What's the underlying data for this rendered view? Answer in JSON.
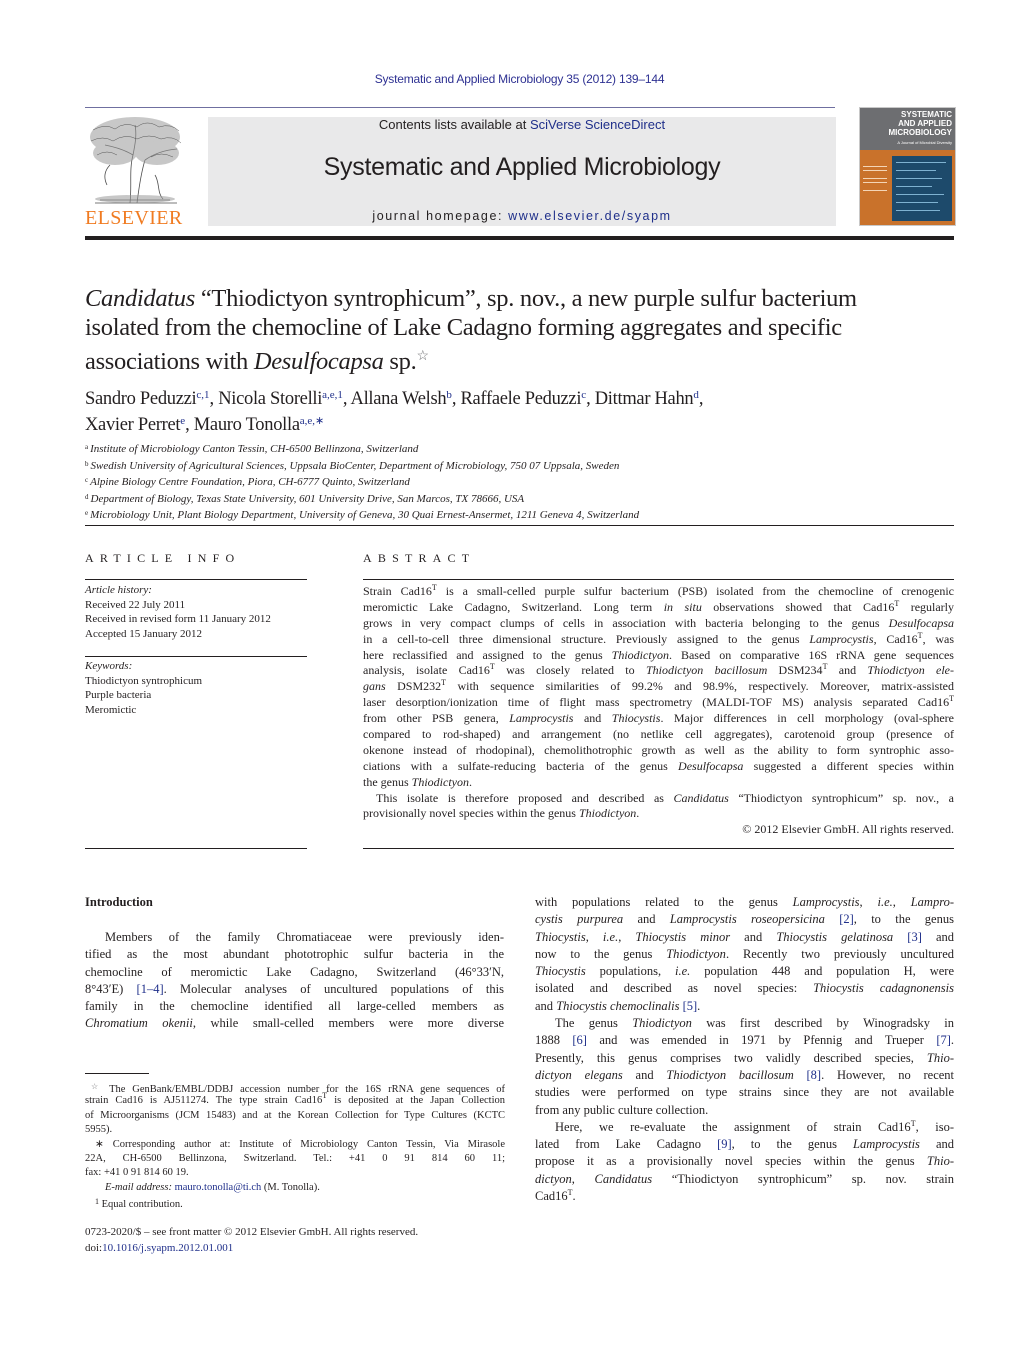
{
  "header": {
    "running_head": "Systematic and Applied Microbiology 35 (2012) 139–144",
    "contents_prefix": "Contents lists available at ",
    "contents_link": "SciVerse ScienceDirect",
    "journal_title": "Systematic and Applied Microbiology",
    "homepage_prefix": "journal homepage: ",
    "homepage_link": "www.elsevier.de/syapm",
    "publisher_logo_text": "ELSEVIER",
    "cover": {
      "title_line1": "SYSTEMATIC",
      "title_line2": "AND APPLIED",
      "title_line3": "MICROBIOLOGY",
      "subtitle": "A Journal of Microbial Diversity"
    },
    "brand_colors": {
      "elsevier_orange": "#f07b21",
      "link_blue": "#1f2f8a",
      "cover_orange": "#c9722b"
    }
  },
  "title": {
    "line1": {
      "italic": "Candidatus",
      "rest": " “Thiodictyon syntrophicum”, sp. nov., a new purple sulfur bacterium"
    },
    "line2": "isolated from the chemocline of Lake Cadagno forming aggregates and specific",
    "line3": {
      "pre": "associations with ",
      "italic": "Desulfocapsa",
      "post": " sp.",
      "footnote_mark": "☆"
    }
  },
  "authors": [
    {
      "name": "Sandro Peduzzi",
      "sup": "c,1",
      "sep": ", "
    },
    {
      "name": "Nicola Storelli",
      "sup": "a,e,1",
      "sep": ", "
    },
    {
      "name": "Allana Welsh",
      "sup": "b",
      "sep": ", "
    },
    {
      "name": "Raffaele Peduzzi",
      "sup": "c",
      "sep": ", "
    },
    {
      "name": "Dittmar Hahn",
      "sup": "d",
      "sep": ","
    },
    {
      "name": "Xavier Perret",
      "sup": "e",
      "sep": ", "
    },
    {
      "name": "Mauro Tonolla",
      "sup": "a,e,∗",
      "sep": ""
    }
  ],
  "affiliations": [
    {
      "letter": "a",
      "text": "Institute of Microbiology Canton Tessin, CH-6500 Bellinzona, Switzerland"
    },
    {
      "letter": "b",
      "text": "Swedish University of Agricultural Sciences, Uppsala BioCenter, Department of Microbiology, 750 07 Uppsala, Sweden"
    },
    {
      "letter": "c",
      "text": "Alpine Biology Centre Foundation, Piora, CH-6777 Quinto, Switzerland"
    },
    {
      "letter": "d",
      "text": "Department of Biology, Texas State University, 601 University Drive, San Marcos, TX 78666, USA"
    },
    {
      "letter": "e",
      "text": "Microbiology Unit, Plant Biology Department, University of Geneva, 30 Quai Ernest-Ansermet, 1211 Geneva 4, Switzerland"
    }
  ],
  "article_info": {
    "heading": "ARTICLE INFO",
    "history_label": "Article history:",
    "history": [
      "Received 22 July 2011",
      "Received in revised form 11 January 2012",
      "Accepted 15 January 2012"
    ],
    "keywords_label": "Keywords:",
    "keywords": [
      "Thiodictyon syntrophicum",
      "Purple bacteria",
      "Meromictic"
    ]
  },
  "abstract": {
    "heading": "ABSTRACT",
    "lines": [
      "Strain Cad16<sup class=\"t\">T</sup> is a small-celled purple sulfur bacterium (PSB) isolated from the chemocline of crenogenic",
      "meromictic Lake Cadagno, Switzerland. Long term <i>in situ</i> observations showed that Cad16<sup class=\"t\">T</sup> regularly",
      "grows in very compact clumps of cells in association with bacteria belonging to the genus <i>Desulfocapsa</i>",
      "in a cell-to-cell three dimensional structure. Previously assigned to the genus <i>Lamprocystis</i>, Cad16<sup class=\"t\">T</sup>, was",
      "here reclassified and assigned to the genus <i>Thiodictyon</i>. Based on comparative 16S rRNA gene sequences",
      "analysis, isolate Cad16<sup class=\"t\">T</sup> was closely related to <i>Thiodictyon bacillosum</i> DSM234<sup class=\"t\">T</sup> and <i>Thiodictyon ele-</i>",
      "<i>gans</i> DSM232<sup class=\"t\">T</sup> with sequence similarities of 99.2% and 98.9%, respectively. Moreover, matrix-assisted",
      "laser desorption/ionization time of flight mass spectrometry (MALDI-TOF MS) analysis separated Cad16<sup class=\"t\">T</sup>",
      "from other PSB genera, <i>Lamprocystis</i> and <i>Thiocystis</i>. Major differences in cell morphology (oval-sphere",
      "compared to rod-shaped) and arrangement (no netlike cell aggregates), carotenoid group (presence of",
      "okenone instead of rhodopinal), chemolithotrophic growth as well as the ability to form syntrophic asso-",
      "ciations with a sulfate-reducing bacteria of the genus <i>Desulfocapsa</i> suggested a different species within",
      "the genus <i>Thiodictyon</i>."
    ],
    "para2_lines": [
      "This isolate is therefore proposed and described as <i>Candidatus</i> “Thiodictyon syntrophicum” sp. nov., a",
      "provisionally novel species within the genus <i>Thiodictyon</i>."
    ],
    "copyright": "© 2012 Elsevier GmbH. All rights reserved."
  },
  "introduction": {
    "heading": "Introduction",
    "left_lines": [
      "Members of the family Chromatiaceae were previously iden-",
      "tified as the most abundant phototrophic sulfur bacteria in the",
      "chemocline of meromictic Lake Cadagno, Switzerland (46°33′N,",
      "8°43′E) <span class=\"link\">[1–4]</span>. Molecular analyses of uncultured populations of this",
      "family in the chemocline identified all large-celled members as",
      "<i>Chromatium okenii</i>, while small-celled members were more diverse"
    ],
    "right_para1": [
      "with populations related to the genus <i>Lamprocystis</i>, <i>i.e.</i>, <i>Lampro-</i>",
      "<i>cystis purpurea</i> and <i>Lamprocystis roseopersicina</i> <span class=\"link\">[2]</span>, to the genus",
      "<i>Thiocystis</i>, <i>i.e.</i>, <i>Thiocystis minor</i> and <i>Thiocystis gelatinosa</i> <span class=\"link\">[3]</span> and",
      "now to the genus <i>Thiodictyon</i>. Recently two previously uncultured",
      "<i>Thiocystis</i> populations, <i>i.e.</i> population 448 and population H, were",
      "isolated and described as novel species: <i>Thiocystis cadagnonensis</i>",
      "and <i>Thiocystis chemoclinalis</i> <span class=\"link\">[5]</span>."
    ],
    "right_para2": [
      "The genus <i>Thiodictyon</i> was first described by Winogradsky in",
      "1888 <span class=\"link\">[6]</span> and was emended in 1971 by Pfennig and Trueper <span class=\"link\">[7]</span>.",
      "Presently, this genus comprises two validly described species, <i>Thio-</i>",
      "<i>dictyon elegans</i> and <i>Thiodictyon bacillosum</i> <span class=\"link\">[8]</span>. However, no recent",
      "studies were performed on type strains since they are not available",
      "from any public culture collection."
    ],
    "right_para3": [
      "Here, we re-evaluate the assignment of strain Cad16<sup class=\"t\">T</sup>, iso-",
      "lated from Lake Cadagno <span class=\"link\">[9]</span>, to the genus <i>Lamprocystis</i> and",
      "propose it as a provisionally novel species within the genus <i>Thio-</i>",
      "<i>dictyon</i>, <i>Candidatus</i> “Thiodictyon syntrophicum” sp. nov. strain",
      "Cad16<sup class=\"t\">T</sup>."
    ]
  },
  "footnotes": {
    "star_lines": [
      "<span class=\"fn-mark\">☆</span> The GenBank/EMBL/DDBJ accession number for the 16S rRNA gene sequences of",
      "strain Cad16 is AJ511274. The type strain Cad16<sup class=\"t\">T</sup> is deposited at the Japan Collection",
      "of Microorganisms (JCM 15483) and at the Korean Collection for Type Cultures (KCTC",
      "5955)."
    ],
    "corresponding_lines": [
      "∗ Corresponding author at: Institute of Microbiology Canton Tessin, Via Mirasole",
      "22A, CH-6500 Bellinzona, Switzerland. Tel.: +41 0 91 814 60 11;",
      "fax: +41 0 91 814 60 19."
    ],
    "email_label": "E-mail address:",
    "email": "mauro.tonolla@ti.ch",
    "email_suffix": " (M. Tonolla).",
    "equal_mark": "1",
    "equal_text": "Equal contribution."
  },
  "front_matter": {
    "issn_line": "0723-2020/$ – see front matter © 2012 Elsevier GmbH. All rights reserved.",
    "doi_prefix": "doi:",
    "doi": "10.1016/j.syapm.2012.01.001"
  }
}
